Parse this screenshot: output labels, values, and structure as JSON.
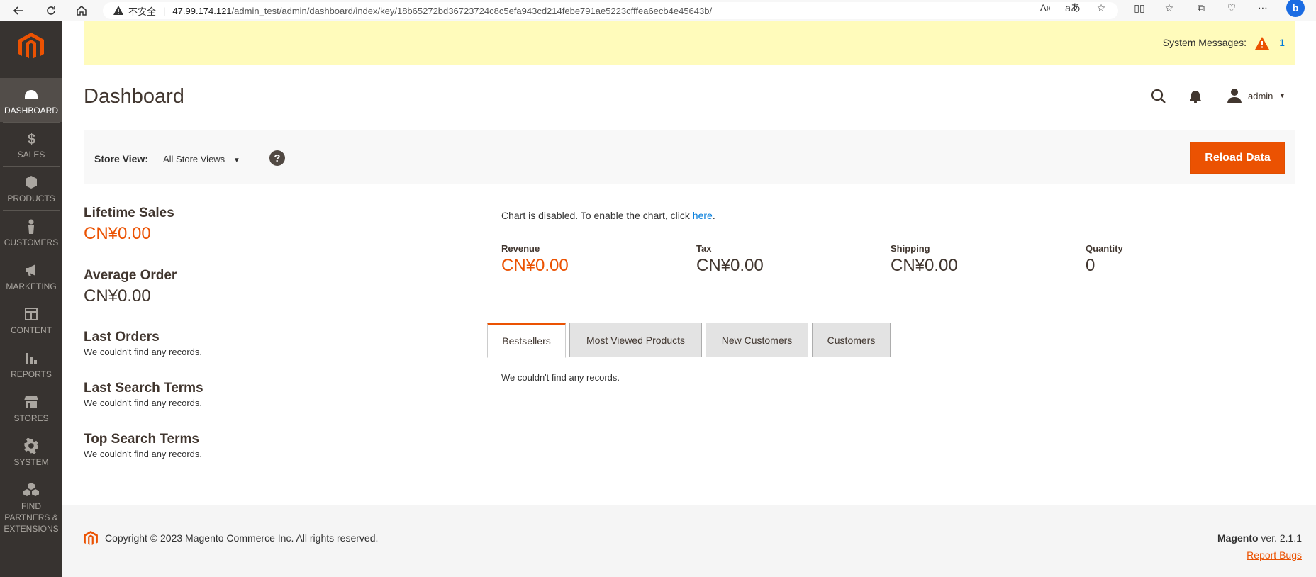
{
  "browser": {
    "insecure_label": "不安全",
    "url_host": "47.99.174.121",
    "url_path": "/admin_test/admin/dashboard/index/key/18b65272bd36723724c8c5efa943cd214febe791ae5223cfffea6ecb4e45643b/"
  },
  "sidebar": {
    "items": [
      {
        "label": "DASHBOARD",
        "icon": "dashboard-icon"
      },
      {
        "label": "SALES",
        "icon": "dollar-icon"
      },
      {
        "label": "PRODUCTS",
        "icon": "box-icon"
      },
      {
        "label": "CUSTOMERS",
        "icon": "person-icon"
      },
      {
        "label": "MARKETING",
        "icon": "megaphone-icon"
      },
      {
        "label": "CONTENT",
        "icon": "layout-icon"
      },
      {
        "label": "REPORTS",
        "icon": "bar-chart-icon"
      },
      {
        "label": "STORES",
        "icon": "storefront-icon"
      },
      {
        "label": "SYSTEM",
        "icon": "gear-icon"
      },
      {
        "label_line1": "FIND",
        "label_line2": "PARTNERS &",
        "label_line3": "EXTENSIONS",
        "icon": "cubes-icon"
      }
    ]
  },
  "system_messages": {
    "label": "System Messages:",
    "count": "1"
  },
  "header": {
    "title": "Dashboard",
    "user": "admin"
  },
  "toolbar": {
    "store_view_label": "Store View:",
    "store_view_value": "All Store Views",
    "help": "?",
    "reload_label": "Reload Data"
  },
  "left": {
    "lifetime_sales_title": "Lifetime Sales",
    "lifetime_sales_value": "CN¥0.00",
    "average_order_title": "Average Order",
    "average_order_value": "CN¥0.00",
    "last_orders_title": "Last Orders",
    "last_orders_empty": "We couldn't find any records.",
    "last_search_title": "Last Search Terms",
    "last_search_empty": "We couldn't find any records.",
    "top_search_title": "Top Search Terms",
    "top_search_empty": "We couldn't find any records."
  },
  "chart_note": {
    "text": "Chart is disabled. To enable the chart, click ",
    "link": "here",
    "end": "."
  },
  "totals": {
    "revenue_label": "Revenue",
    "revenue_value": "CN¥0.00",
    "tax_label": "Tax",
    "tax_value": "CN¥0.00",
    "shipping_label": "Shipping",
    "shipping_value": "CN¥0.00",
    "quantity_label": "Quantity",
    "quantity_value": "0"
  },
  "tabs": {
    "bestsellers": "Bestsellers",
    "most_viewed": "Most Viewed Products",
    "new_customers": "New Customers",
    "customers": "Customers",
    "empty": "We couldn't find any records."
  },
  "footer": {
    "copyright": "Copyright © 2023 Magento Commerce Inc. All rights reserved.",
    "brand": "Magento",
    "version": " ver. 2.1.1",
    "report_bugs": "Report Bugs"
  },
  "colors": {
    "accent": "#eb5202",
    "sidebar_bg": "#373330",
    "link": "#007bdb",
    "sysmsg_bg": "#fffbbb"
  }
}
